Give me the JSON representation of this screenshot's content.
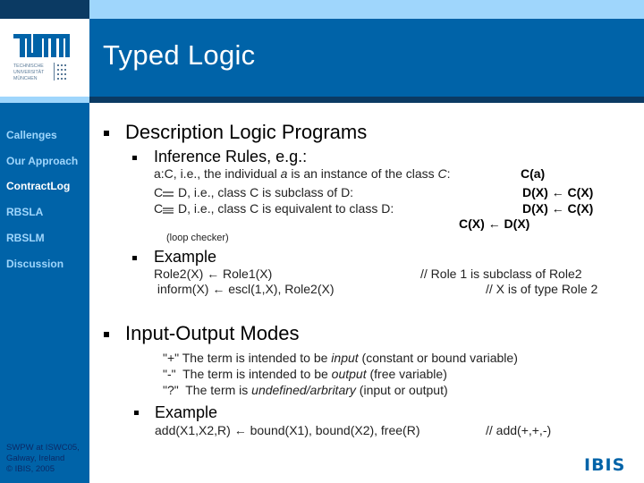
{
  "header": {
    "title": "Typed Logic",
    "logo": {
      "name": "TUM",
      "lines": [
        "TECHNISCHE",
        "UNIVERSITÄT",
        "MÜNCHEN"
      ]
    }
  },
  "sidebar": {
    "items": [
      {
        "label": "Callenges",
        "active": false
      },
      {
        "label": "Our Approach",
        "active": false
      },
      {
        "label": "ContractLog",
        "active": true
      },
      {
        "label": "RBSLA",
        "active": false
      },
      {
        "label": "RBSLM",
        "active": false
      },
      {
        "label": "Discussion",
        "active": false
      }
    ],
    "footer": [
      "SWPW at ISWC05,",
      "Galway, Ireland",
      "© IBIS, 2005"
    ]
  },
  "content": {
    "dlp": {
      "heading": "Description Logic Programs",
      "inference": {
        "heading": "Inference Rules, e.g.:",
        "line1_a": "a:C, i.e., the individual ",
        "line1_italic": "a",
        "line1_b": " is an instance of the class ",
        "line1_italic2": "C",
        "line1_c": ":",
        "line2_pre": "C",
        "line2_post": " D, i.e., class C is subclass of D:",
        "line3_pre": "C",
        "line3_post": " D, i.e., class C is equivalent to class D:",
        "loop_checker": "(loop checker)",
        "rule1": "C(a)",
        "rule2": "D(X) ← C(X)",
        "rule3": "D(X) ← C(X)",
        "rule4": "C(X) ← D(X)"
      },
      "example": {
        "heading": "Example",
        "code1": "Role2(X) ← Role1(X)",
        "code2": " inform(X) ← escl(1,X), Role2(X)",
        "comment1": "// Role 1 is subclass of Role2",
        "comment2": "// X is of type Role 2"
      }
    },
    "io": {
      "heading": "Input-Output Modes",
      "modes": [
        {
          "pre": "\"+\" The term is intended to be ",
          "em": "input",
          "post": " (constant or bound variable)"
        },
        {
          "pre": "\"-\"  The term is intended to be ",
          "em": "output",
          "post": " (free variable)"
        },
        {
          "pre": "\"?\"  The term is ",
          "em": "undefined/arbritary",
          "post": " (input or output)"
        }
      ],
      "example": {
        "heading": "Example",
        "code": "add(X1,X2,R) ← bound(X1), bound(X2), free(R)",
        "comment": "// add(+,+,-)"
      }
    }
  },
  "branding": {
    "ibis_logo": "IBIS",
    "accent": "#0063a8",
    "light": "#9fd6fc",
    "dark": "#0b3a63"
  }
}
